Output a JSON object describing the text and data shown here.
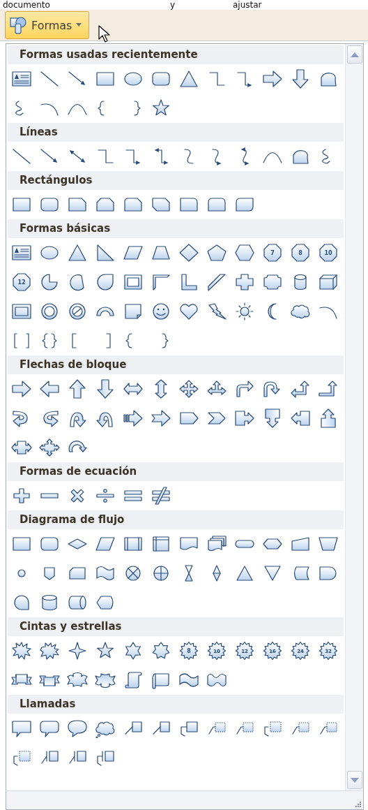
{
  "caption": [
    "documento",
    "y",
    "ajustar"
  ],
  "ribbon": {
    "button": {
      "label": "Formas",
      "pressed": true
    }
  },
  "sections": [
    {
      "title": "Formas usadas recientemente",
      "shapes": [
        {
          "kind": "textbox"
        },
        {
          "kind": "line"
        },
        {
          "kind": "arrowline"
        },
        {
          "kind": "rectangle"
        },
        {
          "kind": "oval"
        },
        {
          "kind": "roundrect"
        },
        {
          "kind": "triangle"
        },
        {
          "kind": "elbow"
        },
        {
          "kind": "elbowarrow"
        },
        {
          "kind": "rightarrow"
        },
        {
          "kind": "downarrow"
        },
        {
          "kind": "freeform"
        },
        {
          "kind": "scribble"
        },
        {
          "kind": "arc"
        },
        {
          "kind": "curve"
        },
        {
          "kind": "leftbrace"
        },
        {
          "kind": "rightbrace"
        },
        {
          "kind": "star5"
        }
      ]
    },
    {
      "title": "Líneas",
      "shapes": [
        {
          "kind": "line"
        },
        {
          "kind": "arrowline"
        },
        {
          "kind": "doublearrowline"
        },
        {
          "kind": "elbow"
        },
        {
          "kind": "elbowarrow"
        },
        {
          "kind": "elbowdoublearrow"
        },
        {
          "kind": "curvedconnector"
        },
        {
          "kind": "curvedarrow"
        },
        {
          "kind": "curveddoublearrow"
        },
        {
          "kind": "curve"
        },
        {
          "kind": "freeform"
        },
        {
          "kind": "scribble"
        }
      ]
    },
    {
      "title": "Rectángulos",
      "shapes": [
        {
          "kind": "rectangle"
        },
        {
          "kind": "roundrect"
        },
        {
          "kind": "snipcorner"
        },
        {
          "kind": "snipsame"
        },
        {
          "kind": "sniproundcorner"
        },
        {
          "kind": "snipdiagonal"
        },
        {
          "kind": "roundcorner"
        },
        {
          "kind": "roundsame"
        },
        {
          "kind": "rounddiagonal"
        }
      ]
    },
    {
      "title": "Formas básicas",
      "shapes": [
        {
          "kind": "textbox"
        },
        {
          "kind": "oval"
        },
        {
          "kind": "triangle"
        },
        {
          "kind": "righttriangle"
        },
        {
          "kind": "parallelogram"
        },
        {
          "kind": "trapezoid"
        },
        {
          "kind": "diamond"
        },
        {
          "kind": "pentagon"
        },
        {
          "kind": "hexagon"
        },
        {
          "kind": "polygon",
          "label": "7"
        },
        {
          "kind": "polygon",
          "label": "8"
        },
        {
          "kind": "polygon",
          "label": "10"
        },
        {
          "kind": "polygon",
          "label": "12"
        },
        {
          "kind": "pie"
        },
        {
          "kind": "chord"
        },
        {
          "kind": "teardrop"
        },
        {
          "kind": "frame"
        },
        {
          "kind": "halfframe"
        },
        {
          "kind": "lshape"
        },
        {
          "kind": "diagonalstripe"
        },
        {
          "kind": "cross"
        },
        {
          "kind": "plaque"
        },
        {
          "kind": "cylinder"
        },
        {
          "kind": "cube"
        },
        {
          "kind": "bevel"
        },
        {
          "kind": "donut"
        },
        {
          "kind": "nosymbol"
        },
        {
          "kind": "blockarc"
        },
        {
          "kind": "foldedcorner"
        },
        {
          "kind": "smiley"
        },
        {
          "kind": "heart"
        },
        {
          "kind": "lightning"
        },
        {
          "kind": "sun"
        },
        {
          "kind": "moon"
        },
        {
          "kind": "cloud"
        },
        {
          "kind": "arc"
        },
        {
          "kind": "doublebracket"
        },
        {
          "kind": "doublebrace"
        },
        {
          "kind": "leftbracket"
        },
        {
          "kind": "rightbracket"
        },
        {
          "kind": "leftbrace"
        },
        {
          "kind": "rightbrace"
        }
      ]
    },
    {
      "title": "Flechas de bloque",
      "shapes": [
        {
          "kind": "rightarrow"
        },
        {
          "kind": "leftarrow"
        },
        {
          "kind": "uparrow"
        },
        {
          "kind": "downarrow"
        },
        {
          "kind": "leftrightarrow"
        },
        {
          "kind": "updownarrow"
        },
        {
          "kind": "quadarrow"
        },
        {
          "kind": "leftrightuparrow"
        },
        {
          "kind": "bentarrow"
        },
        {
          "kind": "uturnarrow"
        },
        {
          "kind": "leftuparrow"
        },
        {
          "kind": "bentuparrow"
        },
        {
          "kind": "curvedrightarrow"
        },
        {
          "kind": "curvedleftarrow"
        },
        {
          "kind": "curveduparrow"
        },
        {
          "kind": "curveddownarrow"
        },
        {
          "kind": "stripedarrow"
        },
        {
          "kind": "notchedarrow"
        },
        {
          "kind": "homeplate"
        },
        {
          "kind": "chevron"
        },
        {
          "kind": "rightcallout"
        },
        {
          "kind": "downcallout"
        },
        {
          "kind": "leftcallout"
        },
        {
          "kind": "upcallout"
        },
        {
          "kind": "leftrightcallout"
        },
        {
          "kind": "quadcallout"
        },
        {
          "kind": "circulararrow"
        }
      ]
    },
    {
      "title": "Formas de ecuación",
      "shapes": [
        {
          "kind": "plus"
        },
        {
          "kind": "minus"
        },
        {
          "kind": "multiply"
        },
        {
          "kind": "divide"
        },
        {
          "kind": "equal"
        },
        {
          "kind": "notequal"
        }
      ]
    },
    {
      "title": "Diagrama de flujo",
      "shapes": [
        {
          "kind": "process"
        },
        {
          "kind": "alternateprocess"
        },
        {
          "kind": "decision"
        },
        {
          "kind": "data"
        },
        {
          "kind": "predefinedprocess"
        },
        {
          "kind": "internalstorage"
        },
        {
          "kind": "document"
        },
        {
          "kind": "multidocument"
        },
        {
          "kind": "terminator"
        },
        {
          "kind": "preparation"
        },
        {
          "kind": "manualinput"
        },
        {
          "kind": "manualoperation"
        },
        {
          "kind": "connector"
        },
        {
          "kind": "offpageconnector"
        },
        {
          "kind": "card"
        },
        {
          "kind": "punchedtape"
        },
        {
          "kind": "summingjunction"
        },
        {
          "kind": "or"
        },
        {
          "kind": "collate"
        },
        {
          "kind": "sort"
        },
        {
          "kind": "extract"
        },
        {
          "kind": "merge"
        },
        {
          "kind": "storeddata"
        },
        {
          "kind": "delay"
        },
        {
          "kind": "sequentialaccess"
        },
        {
          "kind": "magneticdisk"
        },
        {
          "kind": "directaccess"
        },
        {
          "kind": "display"
        }
      ]
    },
    {
      "title": "Cintas y estrellas",
      "shapes": [
        {
          "kind": "explosion"
        },
        {
          "kind": "explosion2"
        },
        {
          "kind": "star4"
        },
        {
          "kind": "star5"
        },
        {
          "kind": "star6"
        },
        {
          "kind": "star7"
        },
        {
          "kind": "starlabel",
          "label": "8"
        },
        {
          "kind": "starlabel",
          "label": "10"
        },
        {
          "kind": "starlabel",
          "label": "12"
        },
        {
          "kind": "starlabel",
          "label": "16"
        },
        {
          "kind": "starlabel",
          "label": "24"
        },
        {
          "kind": "starlabel",
          "label": "32"
        },
        {
          "kind": "ribbonup"
        },
        {
          "kind": "ribbondown"
        },
        {
          "kind": "curvedribbonup"
        },
        {
          "kind": "curvedribbondown"
        },
        {
          "kind": "verticalscroll"
        },
        {
          "kind": "horizontalscroll"
        },
        {
          "kind": "wave"
        },
        {
          "kind": "doublewave"
        }
      ]
    },
    {
      "title": "Llamadas",
      "shapes": [
        {
          "kind": "rectcallout"
        },
        {
          "kind": "roundcallout"
        },
        {
          "kind": "ovalcallout"
        },
        {
          "kind": "cloudcallout"
        },
        {
          "kind": "linecallout"
        },
        {
          "kind": "linecallout"
        },
        {
          "kind": "bentcallout"
        },
        {
          "kind": "dashcallout"
        },
        {
          "kind": "dashcallout"
        },
        {
          "kind": "dashbentcallout"
        },
        {
          "kind": "dashcallout"
        },
        {
          "kind": "dashcallout"
        },
        {
          "kind": "dashbentcallout"
        },
        {
          "kind": "barcallout"
        },
        {
          "kind": "barcallout"
        },
        {
          "kind": "barbentcallout"
        }
      ]
    }
  ]
}
